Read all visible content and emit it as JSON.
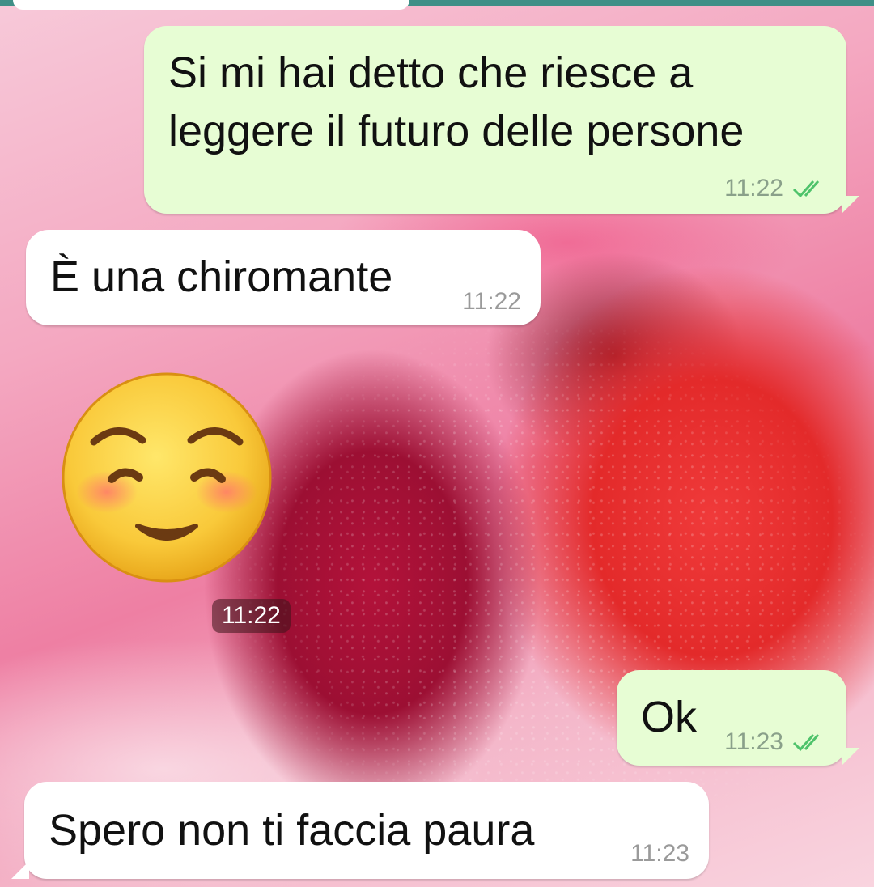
{
  "chat": {
    "messages": [
      {
        "direction": "out",
        "text": "Si mi hai detto che riesce a\nleggere il futuro delle persone",
        "time": "11:22",
        "status": "read"
      },
      {
        "direction": "in",
        "text": "È una chiromante",
        "time": "11:22"
      },
      {
        "direction": "in",
        "type": "emoji",
        "emoji": "smiling-face-with-blush",
        "time": "11:22"
      },
      {
        "direction": "out",
        "text": "Ok",
        "time": "11:23",
        "status": "read"
      },
      {
        "direction": "in",
        "text": "Spero non ti faccia paura",
        "time": "11:23"
      }
    ]
  },
  "colors": {
    "outgoing_bubble": "#e7fdd4",
    "incoming_bubble": "#ffffff",
    "read_ticks": "#4fc36b",
    "header_teal": "#3f8f87"
  }
}
